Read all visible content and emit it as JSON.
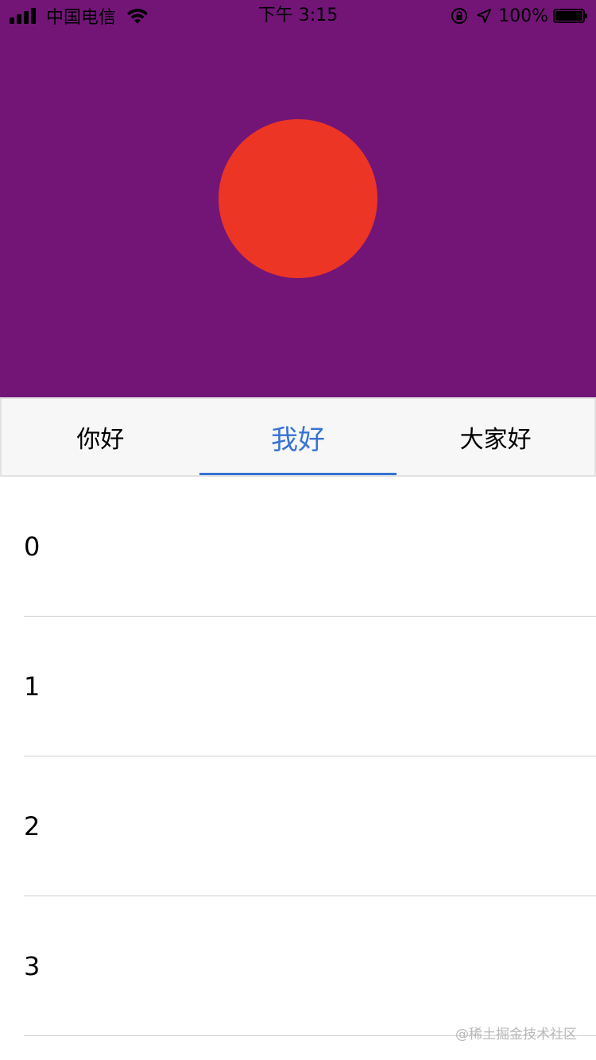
{
  "status_bar": {
    "carrier": "中国电信",
    "time": "下午 3:15",
    "battery_percent": "100%",
    "battery_level": 1.0,
    "signal_bars": 4
  },
  "header": {
    "background_color": "#731577",
    "avatar_color": "#ec3525"
  },
  "tabs": [
    {
      "label": "你好",
      "active": false
    },
    {
      "label": "我好",
      "active": true
    },
    {
      "label": "大家好",
      "active": false
    }
  ],
  "accent_color": "#3773d3",
  "list": {
    "items": [
      "0",
      "1",
      "2",
      "3"
    ]
  },
  "watermark": "@稀土掘金技术社区"
}
